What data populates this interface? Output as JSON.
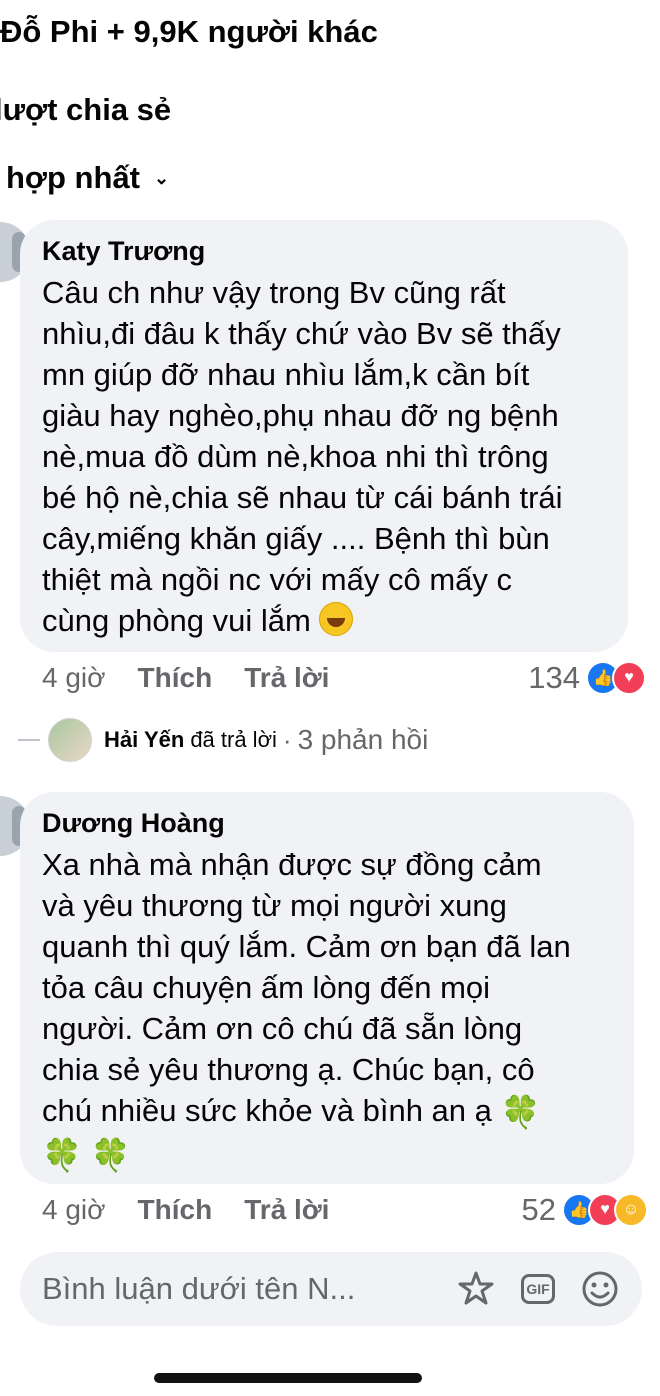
{
  "header": {
    "reactors": "Đỗ Phi + 9,9K người khác",
    "shares": "lượt chia sẻ",
    "sort_label": "hợp nhất",
    "sort_icon": "chevron-down-icon"
  },
  "comments": [
    {
      "author": "Katy Trương",
      "lines": [
        "Câu ch như vậy trong Bv cũng rất",
        "nhìu,đi đâu k thấy chứ vào Bv sẽ thấy",
        "mn giúp đỡ nhau nhìu lắm,k cần bít",
        "giàu hay nghèo,phụ nhau đỡ ng bệnh",
        "nè,mua đồ dùm nè,khoa nhi thì trông",
        "bé hộ nè,chia sẽ nhau từ cái bánh trái",
        "cây,miếng khăn giấy .... Bệnh thì bùn",
        "thiệt mà ngồi nc với mấy cô mấy c",
        "cùng phòng vui lắm"
      ],
      "trailing_emoji": "rolling-laughing-emoji",
      "time": "4 giờ",
      "like_label": "Thích",
      "reply_label": "Trả lời",
      "reaction_count": "134",
      "reactions": [
        "like",
        "love"
      ]
    },
    {
      "author": "Dương Hoàng",
      "lines": [
        "Xa nhà mà nhận được sự đồng cảm",
        "và yêu thương từ mọi người xung",
        "quanh thì quý lắm. Cảm ơn bạn đã lan",
        "tỏa câu chuyện ấm lòng đến mọi",
        "người. Cảm ơn cô chú đã sẵn lòng",
        "chia sẻ yêu thương ạ. Chúc bạn, cô",
        "chú nhiều sức khỏe và bình an ạ"
      ],
      "clover": "🍀",
      "time": "4 giờ",
      "like_label": "Thích",
      "reply_label": "Trả lời",
      "reaction_count": "52",
      "reactions": [
        "like",
        "love",
        "care"
      ]
    }
  ],
  "reply_summary": {
    "name": "Hải Yến",
    "text": "đã trả lời",
    "dot": "·",
    "count": "3 phản hồi"
  },
  "composer": {
    "placeholder": "Bình luận dưới tên N...",
    "icons": [
      "sticker-icon",
      "gif-icon",
      "emoji-icon"
    ],
    "gif_label": "GIF"
  },
  "colors": {
    "bubble": "#f0f2f5",
    "secondary_text": "#65676b",
    "like": "#1877f2",
    "love": "#f33e58",
    "care": "#f7b928"
  }
}
